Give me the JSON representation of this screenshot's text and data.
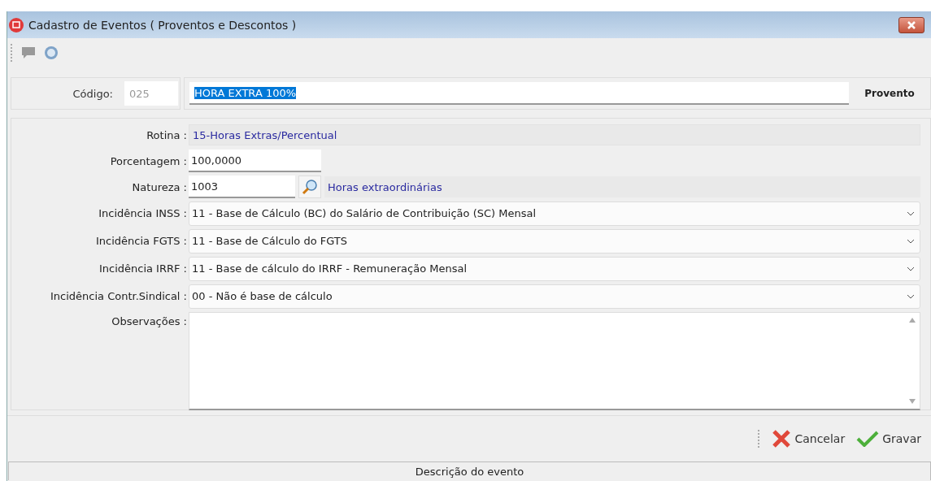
{
  "window": {
    "title": "Cadastro de Eventos ( Proventos e Descontos )"
  },
  "header": {
    "code_label": "Código:",
    "code": "025",
    "description": "HORA EXTRA 100%",
    "description_selected": true,
    "type": "Provento"
  },
  "fields": [
    {
      "kind": "readonly",
      "label": "Rotina :",
      "value": "15-Horas Extras/Percentual"
    },
    {
      "kind": "short",
      "label": "Porcentagem :",
      "value": "100,0000"
    },
    {
      "kind": "lookup",
      "label": "Natureza :",
      "value": "1003",
      "note": "Horas extraordinárias"
    },
    {
      "kind": "select",
      "label": "Incidência INSS :",
      "value": "11 - Base de Cálculo (BC) do Salário de Contribuição (SC) Mensal"
    },
    {
      "kind": "select",
      "label": "Incidência FGTS :",
      "value": "11 - Base de Cálculo do FGTS"
    },
    {
      "kind": "select",
      "label": "Incidência IRRF :",
      "value": "11 - Base de cálculo do IRRF - Remuneração Mensal"
    },
    {
      "kind": "select",
      "label": "Incidência Contr.Sindical :",
      "value": "00 - Não é base de cálculo"
    },
    {
      "kind": "memo",
      "label": "Observações :"
    }
  ],
  "buttons": [
    {
      "kind": "cancel",
      "label": "Cancelar"
    },
    {
      "kind": "save",
      "label": "Gravar"
    }
  ],
  "bottom_tab": "Descrição do evento"
}
